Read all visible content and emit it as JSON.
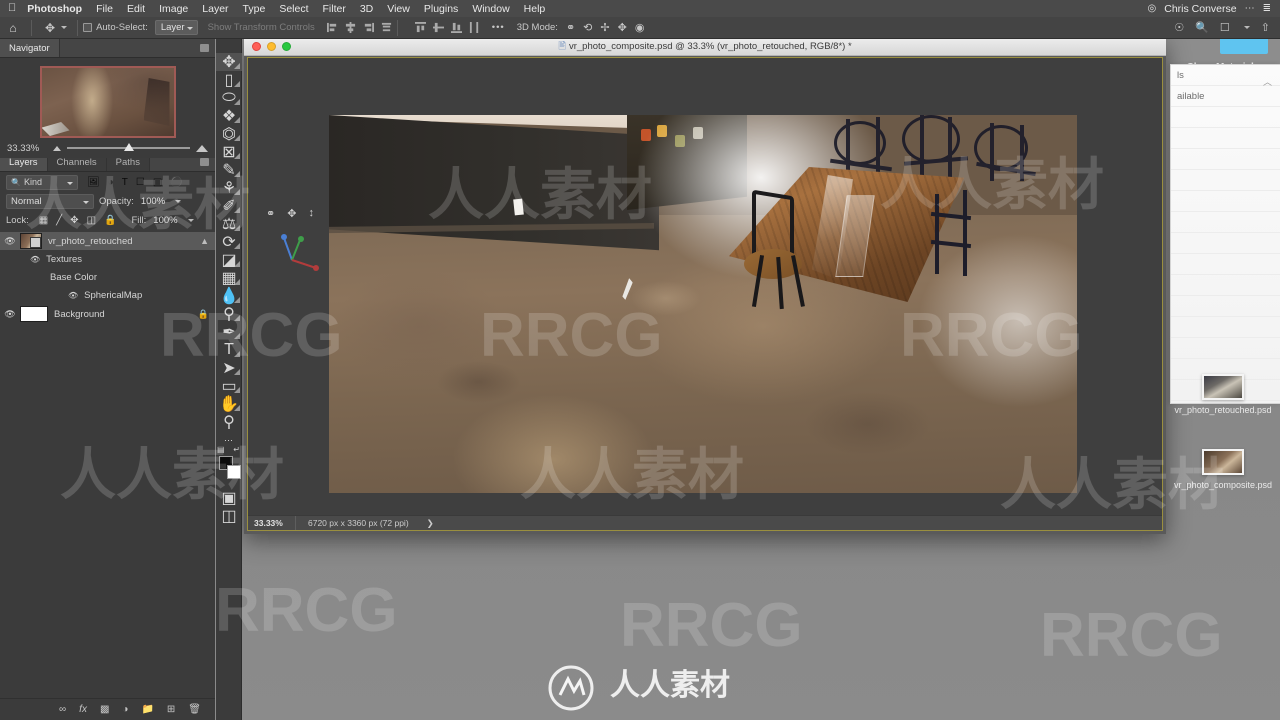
{
  "macbar": {
    "apple_icon": "apple-icon",
    "app_name": "Photoshop",
    "menus": [
      "File",
      "Edit",
      "Image",
      "Layer",
      "Type",
      "Select",
      "Filter",
      "3D",
      "View",
      "Plugins",
      "Window",
      "Help"
    ],
    "user_name": "Chris Converse",
    "status_icons": [
      "record-icon",
      "ellipsis-icon",
      "control-center-icon"
    ]
  },
  "options_bar": {
    "home_icon": "home-icon",
    "tool_icon": "move-tool-icon",
    "auto_select_label": "Auto-Select:",
    "auto_select_value": "Layer",
    "show_transform_label": "Show Transform Controls",
    "more_label": "•••",
    "mode_3d_label": "3D Mode:",
    "right_icons": [
      "search-plus-icon",
      "search-icon",
      "workspace-icon",
      "chevron-down-icon",
      "share-icon"
    ]
  },
  "navigator": {
    "tab_label": "Navigator",
    "menu_icon": "panel-menu-icon",
    "zoom_value": "33.33%",
    "zoom_out_icon": "zoom-out-icon",
    "zoom_in_icon": "zoom-in-icon"
  },
  "layers_panel": {
    "tabs": [
      {
        "label": "Layers",
        "active": true
      },
      {
        "label": "Channels",
        "active": false
      },
      {
        "label": "Paths",
        "active": false
      }
    ],
    "menu_icon": "panel-menu-icon",
    "filter": {
      "search_icon": "search-icon",
      "kind_label": "Kind",
      "icons": [
        "pixel-filter-icon",
        "adjustment-filter-icon",
        "type-filter-icon",
        "shape-filter-icon",
        "smart-object-filter-icon",
        "toggle-filter-icon"
      ]
    },
    "blend_mode": "Normal",
    "opacity_label": "Opacity:",
    "opacity_value": "100%",
    "lock_label": "Lock:",
    "lock_icons": [
      "lock-transparent-icon",
      "lock-image-icon",
      "lock-position-icon",
      "lock-artboard-icon",
      "lock-all-icon"
    ],
    "fill_label": "Fill:",
    "fill_value": "100%",
    "layers": [
      {
        "name": "vr_photo_retouched",
        "indent": 0,
        "visible": true,
        "selected": true,
        "thumb": "smart-object",
        "chevron": "chevron-up-icon"
      },
      {
        "name": "Textures",
        "indent": 1,
        "visible": true,
        "selected": false,
        "thumb": "none"
      },
      {
        "name": "Base Color",
        "indent": 2,
        "visible": false,
        "selected": false,
        "thumb": "none"
      },
      {
        "name": "SphericalMap",
        "indent": 3,
        "visible": true,
        "selected": false,
        "thumb": "none"
      },
      {
        "name": "Background",
        "indent": 0,
        "visible": true,
        "selected": false,
        "thumb": "white",
        "locked": true
      }
    ],
    "footer_icons": [
      "link-layers-icon",
      "layer-style-fx-icon",
      "layer-mask-icon",
      "adjustment-layer-icon",
      "new-group-icon",
      "new-layer-icon",
      "delete-layer-icon"
    ]
  },
  "toolbar": {
    "tools": [
      {
        "name": "move-tool-icon",
        "glyph": "✥",
        "active": true
      },
      {
        "name": "marquee-tool-icon",
        "glyph": "▭",
        "active": false
      },
      {
        "name": "lasso-tool-icon",
        "glyph": "◯",
        "active": false
      },
      {
        "name": "quick-selection-tool-icon",
        "glyph": "✎",
        "active": false
      },
      {
        "name": "crop-tool-icon",
        "glyph": "⌗",
        "active": false
      },
      {
        "name": "frame-tool-icon",
        "glyph": "⊠",
        "active": false
      },
      {
        "name": "eyedropper-tool-icon",
        "glyph": "✐",
        "active": false
      },
      {
        "name": "healing-brush-tool-icon",
        "glyph": "⌇",
        "active": false
      },
      {
        "name": "brush-tool-icon",
        "glyph": "✏",
        "active": false
      },
      {
        "name": "clone-stamp-tool-icon",
        "glyph": "⌼",
        "active": false
      },
      {
        "name": "history-brush-tool-icon",
        "glyph": "⟲",
        "active": false
      },
      {
        "name": "eraser-tool-icon",
        "glyph": "◨",
        "active": false
      },
      {
        "name": "gradient-tool-icon",
        "glyph": "▤",
        "active": false
      },
      {
        "name": "blur-tool-icon",
        "glyph": "💧",
        "active": false
      },
      {
        "name": "dodge-tool-icon",
        "glyph": "🔍",
        "active": false
      },
      {
        "name": "pen-tool-icon",
        "glyph": "✒",
        "active": false
      },
      {
        "name": "type-tool-icon",
        "glyph": "T",
        "active": false
      },
      {
        "name": "path-selection-tool-icon",
        "glyph": "➤",
        "active": false
      },
      {
        "name": "rectangle-tool-icon",
        "glyph": "▭",
        "active": false
      },
      {
        "name": "hand-tool-icon",
        "glyph": "✋",
        "active": false
      },
      {
        "name": "zoom-tool-icon",
        "glyph": "⚲",
        "active": false
      },
      {
        "name": "edit-toolbar-icon",
        "glyph": "•••",
        "active": false
      }
    ],
    "swap_colors_icon": "swap-colors-icon",
    "default_colors_icon": "default-colors-icon",
    "quick_mask_icon": "quick-mask-icon",
    "screen_mode_icon": "screen-mode-icon"
  },
  "document": {
    "title": "vr_photo_composite.psd @ 33.3% (vr_photo_retouched, RGB/8*) *",
    "title_icon": "document-icon",
    "window_controls": [
      "close-button",
      "minimize-button",
      "zoom-button"
    ],
    "status": {
      "zoom": "33.33%",
      "dimensions": "6720 px x 3360 px (72 ppi)",
      "arrow": "❯"
    },
    "viewport_widgets": [
      "orbit-3d-icon",
      "pan-3d-icon",
      "slide-3d-icon"
    ],
    "axis_widget": "3d-axis-gizmo"
  },
  "right_sidebar": {
    "title": "Class Materials",
    "partial_text_1": "ls",
    "partial_text_2": "ailable",
    "collapse_icon": "chevron-up-icon",
    "files": [
      {
        "name": "vr_photo_retouched.psd",
        "thumb": "retouched-thumbnail"
      },
      {
        "name": "vr_photo_composite.psd",
        "thumb": "composite-thumbnail"
      }
    ]
  },
  "watermarks": {
    "cjk": "人人素材",
    "latin": "RRCG"
  }
}
